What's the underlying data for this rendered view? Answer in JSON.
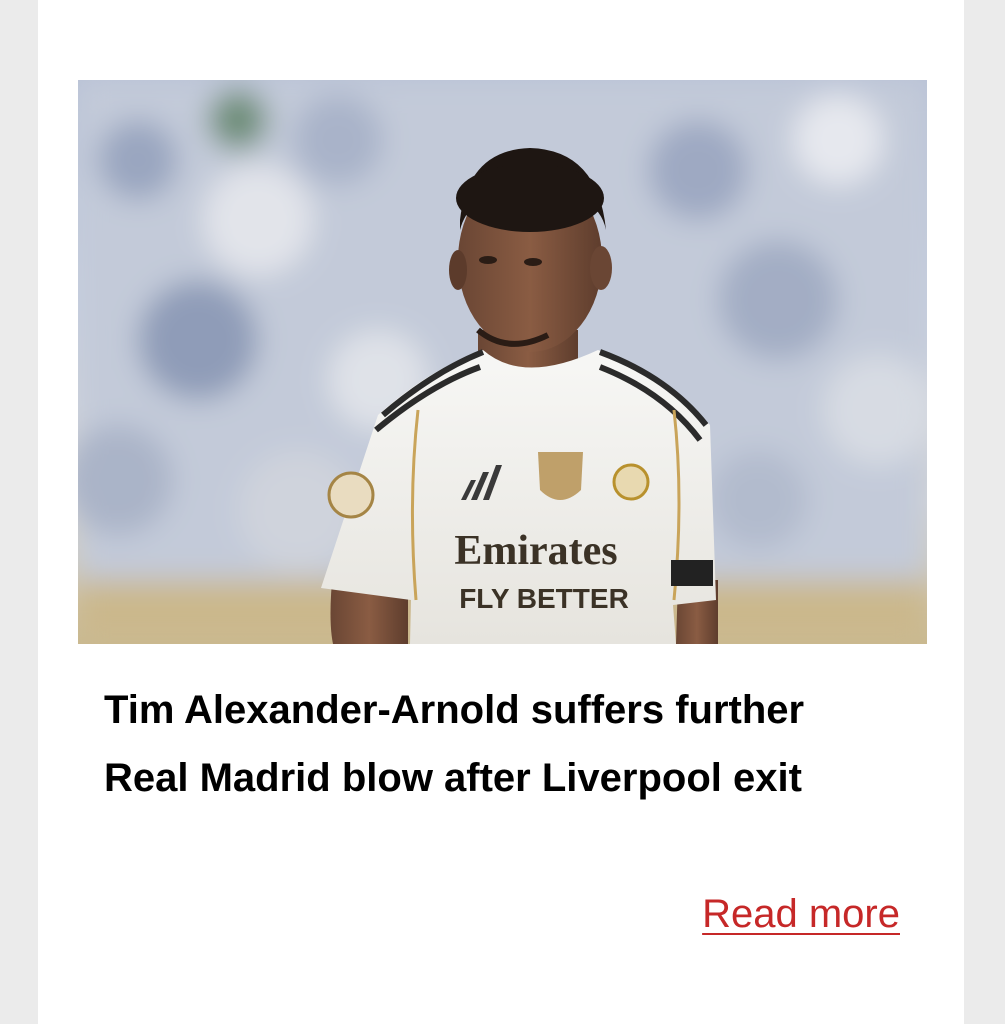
{
  "article": {
    "image_alt": "Footballer in a white Real Madrid kit",
    "headline": "Tim Alexander-Arnold suffers further Real Madrid blow after Liverpool exit",
    "read_more_label": "Read more",
    "sponsor_text_line1": "Emirates",
    "sponsor_text_line2": "FLY BETTER"
  },
  "colors": {
    "background": "#ebebeb",
    "card": "#ffffff",
    "link": "#c62828",
    "headline": "#000000"
  }
}
